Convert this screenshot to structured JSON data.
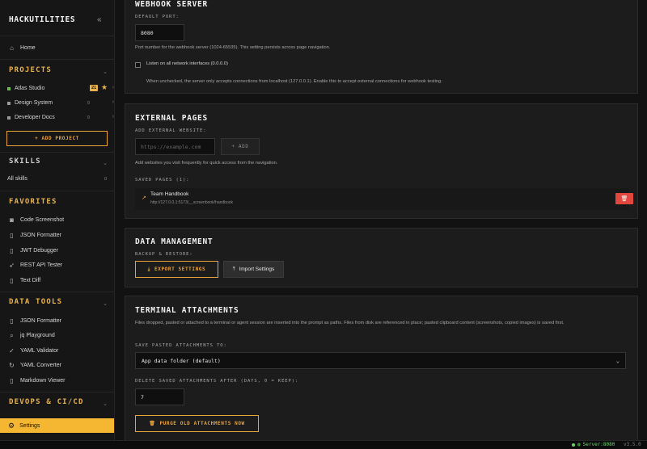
{
  "sidebar": {
    "brand": "HACKUTILITIES",
    "collapse_icon": "double-chevron-left",
    "home": "Home",
    "projects_title": "PROJECTS",
    "projects": [
      {
        "name": "Atlas Studio",
        "color": "#6cc04a",
        "count": "21",
        "starred": true
      },
      {
        "name": "Design System",
        "color": "#9a9a9a",
        "count": "0"
      },
      {
        "name": "Developer Docs",
        "color": "#9a9a9a",
        "count": "0"
      }
    ],
    "add_project": "+ ADD PROJECT",
    "skills_title": "SKILLS",
    "all_skills": "All skills",
    "all_skills_count": "0",
    "favorites_title": "FAVORITES",
    "favorites": [
      "Code Screenshot",
      "JSON Formatter",
      "JWT Debugger",
      "REST API Tester",
      "Text Diff"
    ],
    "data_tools_title": "DATA TOOLS",
    "data_tools": [
      "JSON Formatter",
      "jq Playground",
      "YAML Validator",
      "YAML Converter",
      "Markdown Viewer"
    ],
    "devops_title": "DEVOPS & CI/CD",
    "settings": "Settings"
  },
  "webhook": {
    "title": "WEBHOOK SERVER",
    "port_label": "DEFAULT PORT:",
    "port_value": "8080",
    "port_help": "Port number for the webhook server (1024-65535). This setting persists across page navigation.",
    "listen_label": "Listen on all network interfaces (0.0.0.0)",
    "listen_help": "When unchecked, the server only accepts connections from localhost (127.0.0.1). Enable this to accept external connections for webhook testing."
  },
  "external": {
    "title": "EXTERNAL PAGES",
    "add_label": "ADD EXTERNAL WEBSITE:",
    "url_placeholder": "https://example.com",
    "add_button": "+ ADD",
    "help": "Add websites you visit frequently for quick access from the navigation.",
    "saved_label": "SAVED PAGES (1):",
    "saved": [
      {
        "name": "Team Handbook",
        "url": "http://127.0.0.1:5173/__screenbook/handbook"
      }
    ]
  },
  "data_mgmt": {
    "title": "DATA MANAGEMENT",
    "backup_label": "BACKUP & RESTORE:",
    "export_button": "EXPORT SETTINGS",
    "import_button": "Import Settings"
  },
  "terminal": {
    "title": "TERMINAL ATTACHMENTS",
    "help": "Files dropped, pasted or attached to a terminal or agent session are inserted into the prompt as paths. Files from disk are referenced in place; pasted clipboard content (screenshots, copied images) is saved first.",
    "save_label": "SAVE PASTED ATTACHMENTS TO:",
    "save_value": "App data folder (default)",
    "delete_label": "DELETE SAVED ATTACHMENTS AFTER (DAYS, 0 = KEEP):",
    "delete_value": "7",
    "purge_button": "PURGE OLD ATTACHMENTS NOW"
  },
  "status": {
    "server": "Server:8080",
    "version": "v3.5.0"
  },
  "colors": {
    "accent": "#e8a33a",
    "active": "#f5b731",
    "danger": "#e2473e",
    "ok": "#6cd36a"
  }
}
